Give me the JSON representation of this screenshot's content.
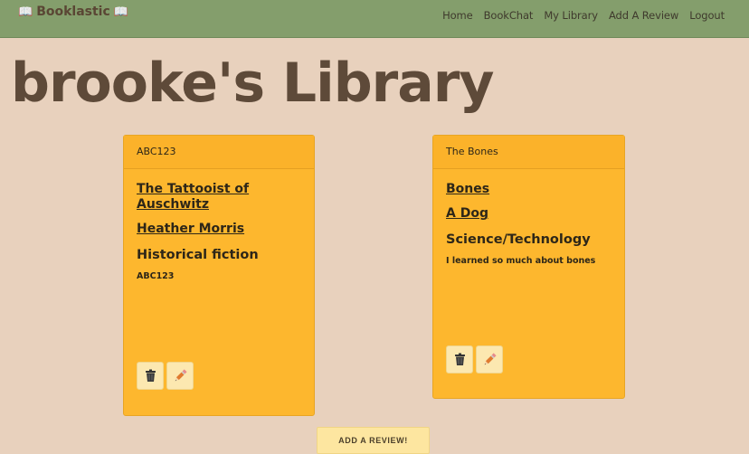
{
  "nav": {
    "brand": "Booklastic",
    "brand_icon_left": "📖",
    "brand_icon_right": "📖",
    "links": [
      "Home",
      "BookChat",
      "My Library",
      "Add A Review",
      "Logout"
    ]
  },
  "page": {
    "title": "brooke's Library"
  },
  "cards": [
    {
      "header": "ABC123",
      "title": "The Tattooist of Auschwitz",
      "author": "Heather Morris",
      "genre": "Historical fiction",
      "review": "ABC123",
      "delete_icon": "trash-icon",
      "edit_icon": "pencil-icon"
    },
    {
      "header": "The Bones",
      "title": "Bones",
      "author": "A Dog",
      "genre": "Science/Technology",
      "review": "I learned so much about bones",
      "delete_icon": "trash-icon",
      "edit_icon": "pencil-icon"
    }
  ],
  "add_review_label": "ADD A REVIEW!",
  "colors": {
    "background": "#e8d1bd",
    "navbar": "#849e6c",
    "card": "#fdb72e",
    "button": "#fde6a0"
  }
}
